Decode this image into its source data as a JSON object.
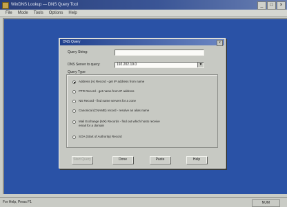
{
  "window": {
    "title": "WinDNS Lookup — DNS Query Tool",
    "menu": [
      "File",
      "Mode",
      "Tools",
      "Options",
      "Help"
    ]
  },
  "status": {
    "left": "For Help, Press F1",
    "num": "NUM"
  },
  "dialog": {
    "title": "DNS Query",
    "close_glyph": "x",
    "query_string_label": "Query String:",
    "query_string_value": "",
    "dns_server_label": "DNS Server to query:",
    "dns_server_value": "192.202.19.0",
    "query_type_label": "Query Type",
    "options": [
      {
        "label": "Address (A) Record - get IP address from name",
        "selected": true
      },
      {
        "label": "PTR Record - get name from IP address",
        "selected": false
      },
      {
        "label": "NS Record - find name servers for a zone",
        "selected": false
      },
      {
        "label": "Canonical (CNAME) record - resolve an alias name",
        "selected": false
      },
      {
        "label": "Mail Exchange (MX) Records - find out which hosts receive email for a domain",
        "selected": false
      },
      {
        "label": "SOA (Start of Authority) Record",
        "selected": false
      }
    ],
    "buttons": {
      "start": "Start Query",
      "done": "Done",
      "paste": "Paste",
      "help": "Help"
    }
  }
}
